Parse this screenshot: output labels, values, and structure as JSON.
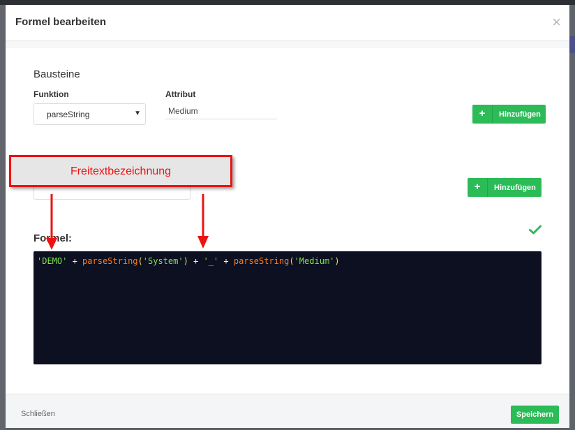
{
  "modal": {
    "title": "Formel bearbeiten",
    "close_symbol": "×",
    "section_title": "Bausteine",
    "function_label": "Funktion",
    "function_value": "parseString",
    "attribute_label": "Attribut",
    "attribute_value": "Medium",
    "add_button_label": "Hinzufügen",
    "add_button_label_2": "Hinzufügen",
    "formula_label": "Formel:",
    "formula_tokens": [
      {
        "t": "'DEMO'",
        "k": "str"
      },
      {
        "t": " + ",
        "k": "op"
      },
      {
        "t": "parseString",
        "k": "fn"
      },
      {
        "t": "(",
        "k": "par"
      },
      {
        "t": "'System'",
        "k": "str"
      },
      {
        "t": ")",
        "k": "par"
      },
      {
        "t": " + ",
        "k": "op"
      },
      {
        "t": "'_'",
        "k": "str"
      },
      {
        "t": " + ",
        "k": "op"
      },
      {
        "t": "parseString",
        "k": "fn"
      },
      {
        "t": "(",
        "k": "par"
      },
      {
        "t": "'Medium'",
        "k": "str"
      },
      {
        "t": ")",
        "k": "par"
      }
    ],
    "footer": {
      "close_label": "Schließen",
      "save_label": "Speichern"
    }
  },
  "annotation": {
    "callout_text": "Freitextbezeichnung"
  },
  "colors": {
    "accent_green": "#2bbb57",
    "annotation_red": "#ee1111",
    "editor_bg": "#0d1020"
  },
  "icons": [
    "close-icon",
    "plus-icon",
    "chevron-down-icon",
    "check-icon"
  ]
}
